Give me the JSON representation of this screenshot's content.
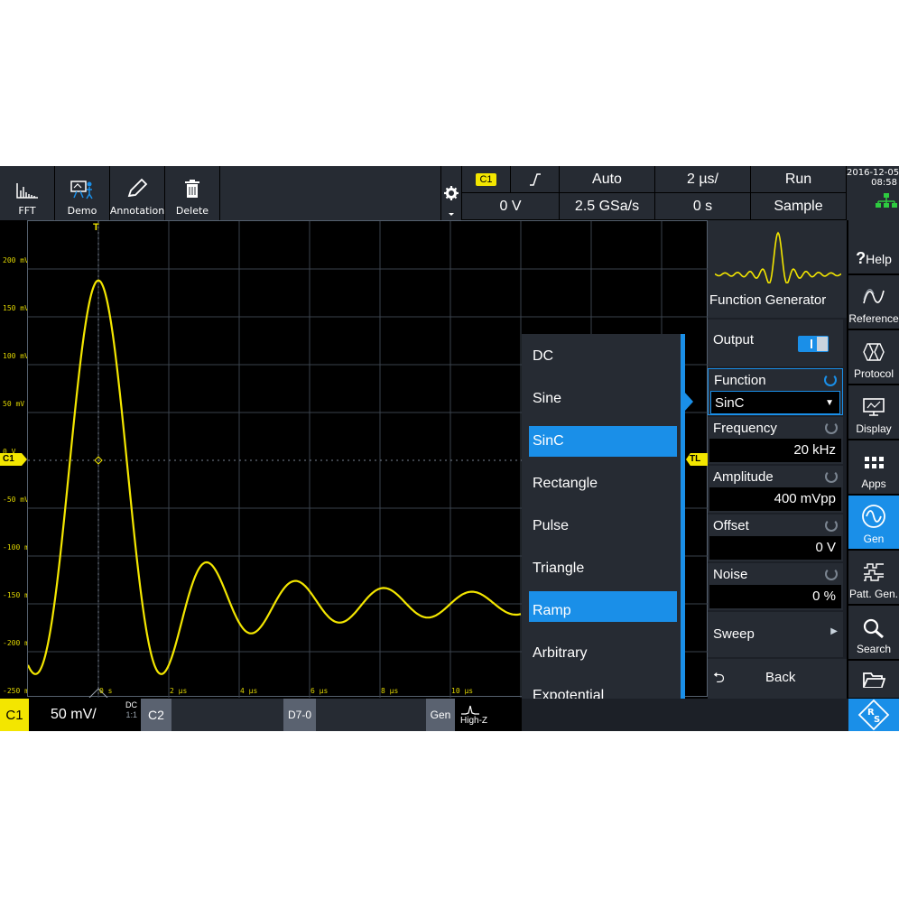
{
  "toolbar": {
    "buttons": [
      {
        "label": "FFT",
        "icon": "fft-icon"
      },
      {
        "label": "Demo",
        "icon": "demo-icon"
      },
      {
        "label": "Annotation",
        "icon": "pencil-icon"
      },
      {
        "label": "Delete",
        "icon": "trash-icon"
      }
    ]
  },
  "acquisition": {
    "channel": "C1",
    "trigger_slope": "rising-edge",
    "trigger_level": "0 V",
    "trigger_mode": "Auto",
    "sample_rate": "2.5 GSa/s",
    "timebase": "2 µs/",
    "position": "0 s",
    "run_state": "Run",
    "acq_mode": "Sample"
  },
  "datetime": {
    "date": "2016-12-05",
    "time": "08:58"
  },
  "plot": {
    "ylabels": [
      "200 mV",
      "150 mV",
      "100 mV",
      "50 mV",
      "0 V",
      "-50 mV",
      "-100 mV",
      "-150 mV",
      "-200 mV",
      "-250 mV"
    ],
    "xlabels": [
      "0 s",
      "2 µs",
      "4 µs",
      "6 µs",
      "8 µs",
      "10 µs"
    ],
    "trigger_marker": "T",
    "channel_marker": "C1",
    "trigger_level_marker": "TL",
    "trace_color": "#f3e600"
  },
  "function_menu": {
    "options": [
      "DC",
      "Sine",
      "SinC",
      "Rectangle",
      "Pulse",
      "Triangle",
      "Ramp",
      "Arbitrary",
      "Expotential"
    ],
    "selected": "SinC"
  },
  "panel": {
    "title": "Function Generator",
    "output_label": "Output",
    "output_on": true,
    "function_label": "Function",
    "function_value": "SinC",
    "frequency_label": "Frequency",
    "frequency_value": "20 kHz",
    "amplitude_label": "Amplitude",
    "amplitude_value": "400 mVpp",
    "offset_label": "Offset",
    "offset_value": "0 V",
    "noise_label": "Noise",
    "noise_value": "0 %",
    "sweep_label": "Sweep",
    "back_label": "Back"
  },
  "sidenav": {
    "items": [
      {
        "label": "Help",
        "icon": "help-icon"
      },
      {
        "label": "Reference",
        "icon": "reference-icon"
      },
      {
        "label": "Protocol",
        "icon": "protocol-icon"
      },
      {
        "label": "Display",
        "icon": "display-icon"
      },
      {
        "label": "Apps",
        "icon": "apps-icon"
      },
      {
        "label": "Gen",
        "icon": "sine-wave-icon"
      },
      {
        "label": "Patt. Gen.",
        "icon": "pattern-icon"
      },
      {
        "label": "Search",
        "icon": "search-icon"
      },
      {
        "label": "",
        "icon": "folder-icon"
      }
    ]
  },
  "bottom": {
    "c1_label": "C1",
    "c1_scale": "50 mV/",
    "c1_coupling": "DC",
    "c1_probe": "1:1",
    "c2_label": "C2",
    "digital_label": "D7-0",
    "gen_label": "Gen",
    "gen_load": "High-Z"
  }
}
